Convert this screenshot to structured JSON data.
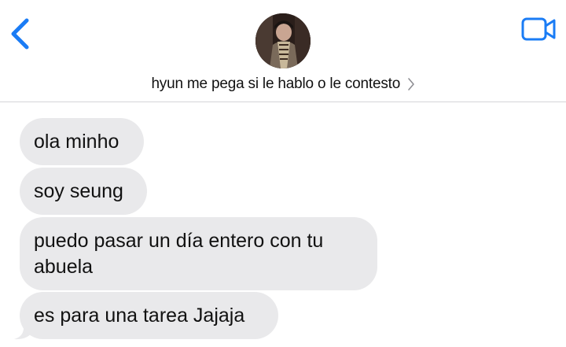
{
  "header": {
    "back_icon": "chevron-left-icon",
    "video_icon": "video-camera-icon",
    "avatar_icon": "contact-avatar",
    "contact_name": "hyun me pega si le hablo o le contesto",
    "contact_chevron_icon": "chevron-right-icon"
  },
  "colors": {
    "accent": "#1a7cf5",
    "bubble_incoming": "#e9e9eb",
    "divider": "#d4d4d8"
  },
  "messages": [
    {
      "text": "ola minho",
      "direction": "incoming"
    },
    {
      "text": "soy seung",
      "direction": "incoming"
    },
    {
      "text": "puedo pasar un día entero con tu abuela",
      "direction": "incoming"
    },
    {
      "text": "es para una tarea Jajaja",
      "direction": "incoming"
    }
  ]
}
